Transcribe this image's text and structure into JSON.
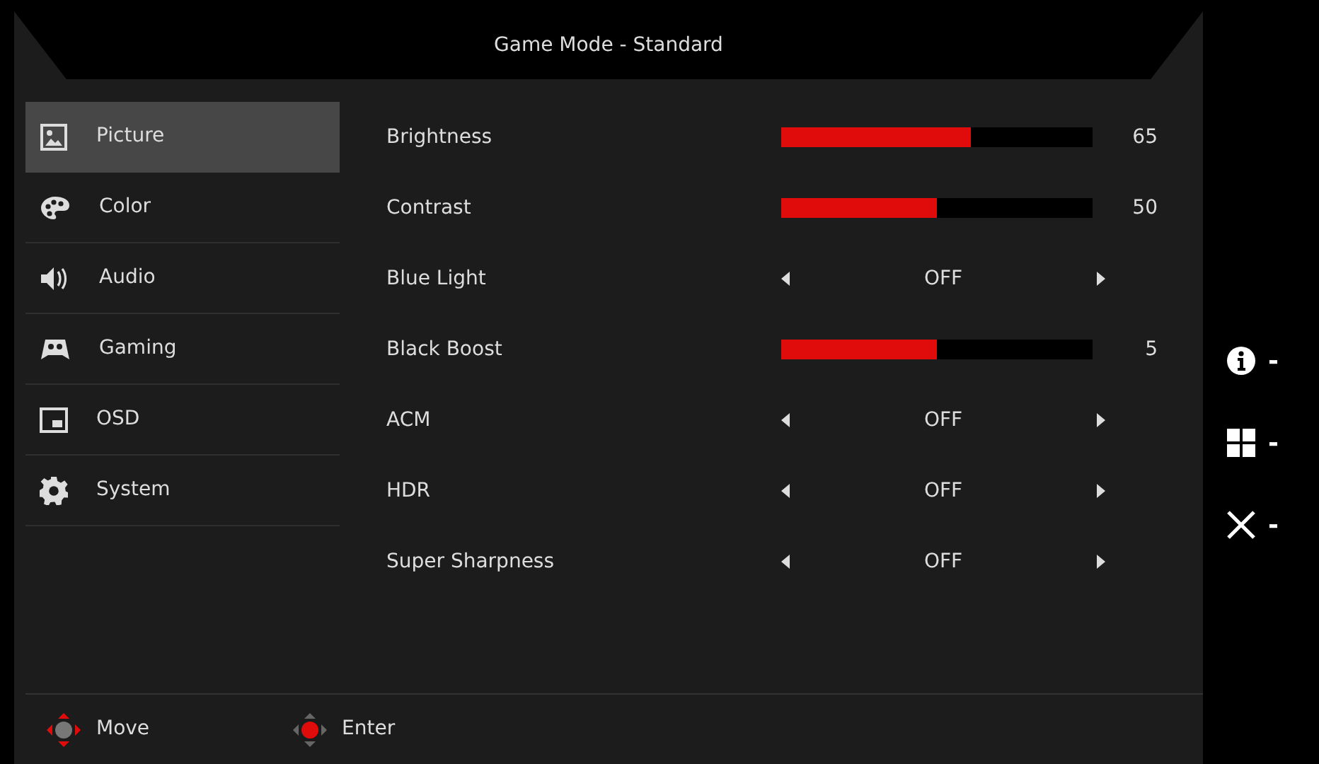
{
  "title": "Game Mode - Standard",
  "menu": [
    {
      "label": "Picture",
      "selected": true
    },
    {
      "label": "Color",
      "selected": false
    },
    {
      "label": "Audio",
      "selected": false
    },
    {
      "label": "Gaming",
      "selected": false
    },
    {
      "label": "OSD",
      "selected": false
    },
    {
      "label": "System",
      "selected": false
    }
  ],
  "settings": [
    {
      "kind": "slider",
      "label": "Brightness",
      "level": 0.61,
      "value": "65"
    },
    {
      "kind": "slider",
      "label": "Contrast",
      "level": 0.5,
      "value": "50"
    },
    {
      "kind": "choice",
      "label": "Blue Light",
      "value": "OFF"
    },
    {
      "kind": "slider",
      "label": "Black Boost",
      "level": 0.5,
      "value": "5"
    },
    {
      "kind": "choice",
      "label": "ACM",
      "value": "OFF"
    },
    {
      "kind": "choice",
      "label": "HDR",
      "value": "OFF"
    },
    {
      "kind": "choice",
      "label": "Super Sharpness",
      "value": "OFF"
    }
  ],
  "footer": [
    {
      "label": "Move"
    },
    {
      "label": "Enter"
    }
  ],
  "keys": [
    {
      "label": "-"
    },
    {
      "label": "-"
    },
    {
      "label": "-"
    }
  ]
}
